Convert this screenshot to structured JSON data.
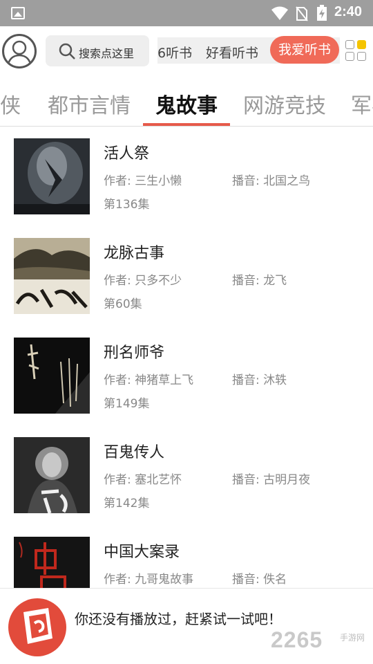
{
  "status_bar": {
    "time": "2:40",
    "icons": [
      "gallery-icon",
      "wifi-icon",
      "no-sim-icon",
      "battery-charging-icon"
    ]
  },
  "header": {
    "search_placeholder": "搜索点这里",
    "quick_tabs": [
      {
        "label": "6听书"
      },
      {
        "label": "好看听书"
      },
      {
        "label": "我爱听书",
        "active": true
      }
    ],
    "accent_color": "#f06a58"
  },
  "category_tabs": [
    {
      "label": "武侠"
    },
    {
      "label": "都市言情"
    },
    {
      "label": "鬼故事",
      "active": true
    },
    {
      "label": "网游竞技"
    },
    {
      "label": "军事"
    }
  ],
  "books": [
    {
      "title": "活人祭",
      "author": "作者: 三生小懒",
      "narrator": "播音: 北国之鸟",
      "episode": "第136集"
    },
    {
      "title": "龙脉古事",
      "author": "作者: 只多不少",
      "narrator": "播音: 龙飞",
      "episode": "第60集"
    },
    {
      "title": "刑名师爷",
      "author": "作者: 神猪草上飞",
      "narrator": "播音: 沐轶",
      "episode": "第149集"
    },
    {
      "title": "百鬼传人",
      "author": "作者: 塞北艺怀",
      "narrator": "播音: 古明月夜",
      "episode": "第142集"
    },
    {
      "title": "中国大案录",
      "author": "作者: 九哥鬼故事",
      "narrator": "播音: 佚名",
      "episode": ""
    }
  ],
  "player": {
    "message": "你还没有播放过，赶紧试一试吧！"
  },
  "watermark": {
    "main": "2265",
    "sub": "手游网"
  }
}
